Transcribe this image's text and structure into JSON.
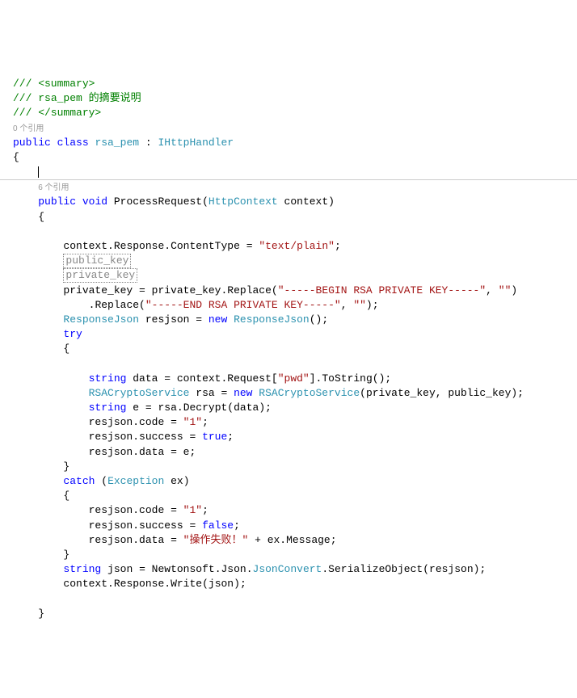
{
  "comments": {
    "line1": "/// <summary>",
    "line2_prefix": "/// ",
    "line2_text": "rsa_pem 的摘要说明",
    "line3": "/// </summary>"
  },
  "codelens": {
    "refs0": "0 个引用",
    "refs6": "6 个引用"
  },
  "kw": {
    "public": "public",
    "class": "class",
    "void": "void",
    "new": "new",
    "try": "try",
    "catch": "catch",
    "string_kw": "string",
    "true": "true",
    "false": "false"
  },
  "types": {
    "rsa_pem": "rsa_pem",
    "IHttpHandler": "IHttpHandler",
    "HttpContext": "HttpContext",
    "ResponseJson": "ResponseJson",
    "RSACryptoService": "RSACryptoService",
    "Exception": "Exception",
    "JsonConvert": "JsonConvert"
  },
  "placeholders": {
    "public_key": "public_key",
    "private_key": "private_key"
  },
  "idents": {
    "ProcessRequest": "ProcessRequest",
    "context": "context",
    "Response": "Response",
    "ContentType": "ContentType",
    "private_key": "private_key",
    "Replace": "Replace",
    "resjson": "resjson",
    "data": "data",
    "Request": "Request",
    "ToString": "ToString",
    "rsa": "rsa",
    "public_key": "public_key",
    "e": "e",
    "Decrypt": "Decrypt",
    "code": "code",
    "success": "success",
    "dataProp": "data",
    "ex": "ex",
    "Message": "Message",
    "json": "json",
    "Newtonsoft": "Newtonsoft",
    "Json": "Json",
    "SerializeObject": "SerializeObject",
    "Write": "Write"
  },
  "strings": {
    "textplain": "\"text/plain\"",
    "beginkey": "\"-----BEGIN RSA PRIVATE KEY-----\"",
    "empty": "\"\"",
    "endkey": "\"-----END RSA PRIVATE KEY-----\"",
    "pwd": "\"pwd\"",
    "one": "\"1\"",
    "failmsg": "\"操作失败！\""
  },
  "punct": {
    "colon": " : ",
    "obrace": "{",
    "cbrace": "}",
    "oparen": "(",
    "cparen": ")",
    "semi": ";",
    "eq": " = ",
    "dot": ".",
    "comma": ", ",
    "osq": "[",
    "csq": "]",
    "plus": " + "
  }
}
